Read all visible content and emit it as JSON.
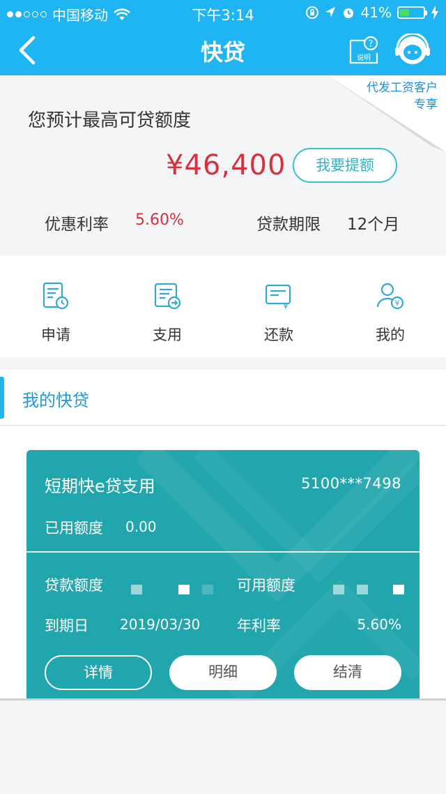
{
  "status": {
    "carrier": "中国移动",
    "time": "下午3:14",
    "battery": "41%",
    "battery_level": 0.41
  },
  "nav": {
    "title": "快贷",
    "help_label": "说明"
  },
  "summary": {
    "corner_line1": "代发工资客户",
    "corner_line2": "专享",
    "title": "您预计最高可贷额度",
    "amount": "¥46,400",
    "raise_button": "我要提额",
    "rate_label": "优惠利率",
    "rate_value": "5.60%",
    "term_label": "贷款期限",
    "term_value": "12个月"
  },
  "actions": [
    {
      "label": "申请",
      "icon": "apply-icon"
    },
    {
      "label": "支用",
      "icon": "withdraw-icon"
    },
    {
      "label": "还款",
      "icon": "repay-icon"
    },
    {
      "label": "我的",
      "icon": "mine-icon"
    }
  ],
  "section": {
    "title": "我的快贷"
  },
  "card": {
    "title": "短期快e贷支用",
    "account": "5100***7498",
    "used_label": "已用额度",
    "used_value": "0.00",
    "loan_label": "贷款额度",
    "available_label": "可用额度",
    "due_label": "到期日",
    "due_value": "2019/03/30",
    "annual_rate_label": "年利率",
    "annual_rate_value": "5.60%",
    "buttons": [
      "详情",
      "明细",
      "结清"
    ]
  },
  "colors": {
    "nav": "#1fb4f2",
    "card": "#22a6ad",
    "amount": "#d9303f",
    "accent": "#2fb3c7"
  }
}
